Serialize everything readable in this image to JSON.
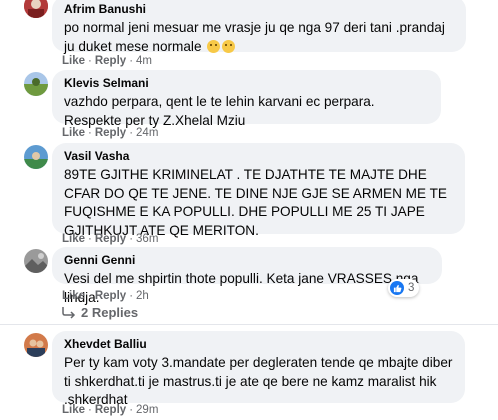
{
  "comments": [
    {
      "author": "Afrim Banushi",
      "text": "po normal jeni mesuar me vrasje ju qe nga 97 deri tani .prandaj ju duket mese normale",
      "like": "Like",
      "reply": "Reply",
      "time": "4m",
      "avatar_color": "#b23a3a"
    },
    {
      "author": "Klevis Selmani",
      "text": "vazhdo perpara, qent le te lehin karvani ec perpara. Respekte per ty Z.Xhelal Mziu",
      "like": "Like",
      "reply": "Reply",
      "time": "24m",
      "avatar_color": "#7a9a4a"
    },
    {
      "author": "Vasil Vasha",
      "text": "89TE GJITHE KRIMINELAT . TE DJATHTE TE MAJTE DHE CFAR DO QE TE JENE. TE DINE NJE GJE SE ARMEN ME TE FUQISHME E KA POPULLI. DHE POPULLI ME 25 TI JAPE GJITHKUJT ATE QE MERITON.",
      "like": "Like",
      "reply": "Reply",
      "time": "36m",
      "avatar_color": "#3e7fb5"
    },
    {
      "author": "Genni Genni",
      "text": "Vesi del me shpirtin thote populli. Keta jane VRASSES nga lindja.",
      "like": "Like",
      "reply": "Reply",
      "time": "2h",
      "avatar_color": "#8a8a8a",
      "reaction_count": "3"
    },
    {
      "author": "Xhevdet Balliu",
      "text": "Per ty kam voty 3.mandate per degleraten tende qe mbajte diber ti shkerdhat.ti je mastrus.ti je ate qe bere ne kamz maralist hik .shkerdhat",
      "like": "Like",
      "reply": "Reply",
      "time": "29m",
      "avatar_color": "#c0603a"
    }
  ],
  "view_replies": "2 Replies",
  "separator": "·"
}
